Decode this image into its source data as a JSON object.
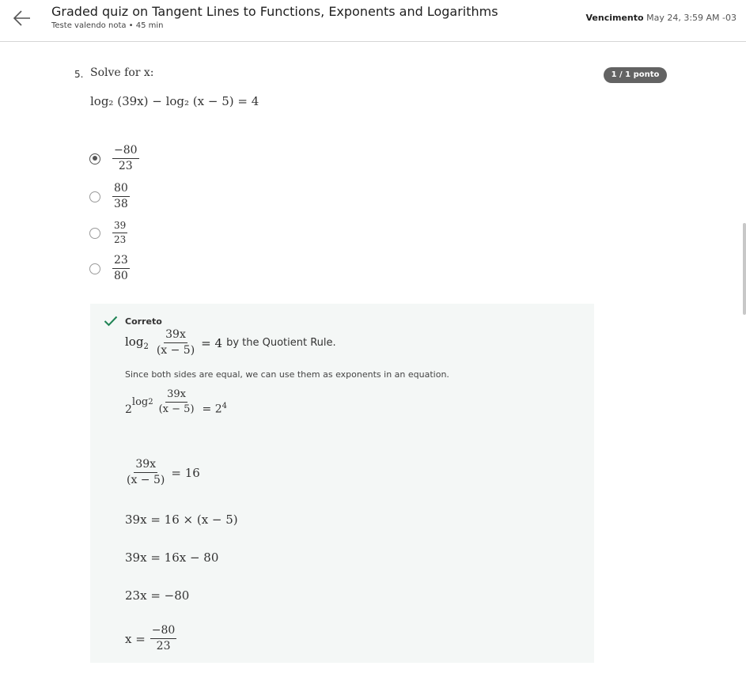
{
  "header": {
    "title": "Graded quiz on Tangent Lines to Functions, Exponents and Logarithms",
    "subtitle": "Teste valendo nota • 45 min",
    "due_label": "Vencimento",
    "due_value": "May 24, 3:59 AM -03"
  },
  "question": {
    "number": "5.",
    "prompt": "Solve for x:",
    "score_badge": "1 / 1 ponto",
    "equation": "log₂ (39x) − log₂ (x − 5) = 4",
    "options": [
      {
        "numerator": "−80",
        "denominator": "23",
        "selected": true
      },
      {
        "numerator": "80",
        "denominator": "38",
        "selected": false
      },
      {
        "numerator": "39",
        "denominator": "23",
        "selected": false
      },
      {
        "numerator": "23",
        "denominator": "80",
        "selected": false
      }
    ]
  },
  "explanation": {
    "status": "Correto",
    "step1": {
      "log": "log",
      "base": "2",
      "numerator": "39x",
      "denominator": "(x − 5)",
      "rhs": "= 4",
      "rule": "by the Quotient Rule."
    },
    "note": "Since both sides are equal, we can use them as exponents in an equation.",
    "step2": {
      "base": "2",
      "exp_log": "log",
      "exp_base": "2",
      "exp_numerator": "39x",
      "exp_denominator": "(x − 5)",
      "rhs": "= 2",
      "rhs_exp": "4"
    },
    "step3": {
      "numerator": "39x",
      "denominator": "(x − 5)",
      "rhs": "= 16"
    },
    "step4": "39x = 16 × (x − 5)",
    "step5": "39x = 16x − 80",
    "step6": "23x = −80",
    "step7": {
      "lhs": "x =",
      "numerator": "−80",
      "denominator": "23"
    }
  },
  "colors": {
    "check": "#1f8354",
    "badge": "#636363",
    "explanation_bg": "#f4f7f6"
  }
}
